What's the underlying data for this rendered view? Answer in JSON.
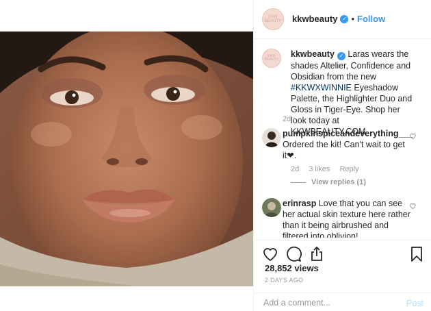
{
  "header": {
    "avatar_text": "KKW BEAUTY",
    "username": "kkwbeauty",
    "separator": "•",
    "follow_label": "Follow"
  },
  "caption": {
    "username": "kkwbeauty",
    "text_before": "Laras wears the shades Altelier, Confidence and Obsidian from the new ",
    "hashtag": "#KKWXWINNIE",
    "text_after": " Eyeshadow Palette, the Highlighter Duo and Gloss in Tiger-Eye. Shop her look today at KKWBEAUTY.COM",
    "age": "2d"
  },
  "comments": [
    {
      "username": "pumpkinspiceandeverything___",
      "text": "Ordered the kit! Can't wait to get it❤.",
      "age": "2d",
      "likes": "3 likes",
      "reply_label": "Reply",
      "view_replies": "View replies (1)"
    },
    {
      "username": "erinrasp",
      "text": "Love that you can see her actual skin texture here rather than it being airbrushed and filtered into oblivion!"
    }
  ],
  "actions": {
    "icons": [
      "heart-icon",
      "comment-icon",
      "share-icon",
      "bookmark-icon"
    ],
    "views": "28,852 views",
    "timestamp": "2 DAYS AGO"
  },
  "add_comment": {
    "placeholder": "Add a comment...",
    "post_label": "Post"
  },
  "colors": {
    "link_blue": "#3897f0",
    "hashtag": "#003569",
    "muted": "#999999",
    "post_disabled": "#b2dffc"
  }
}
